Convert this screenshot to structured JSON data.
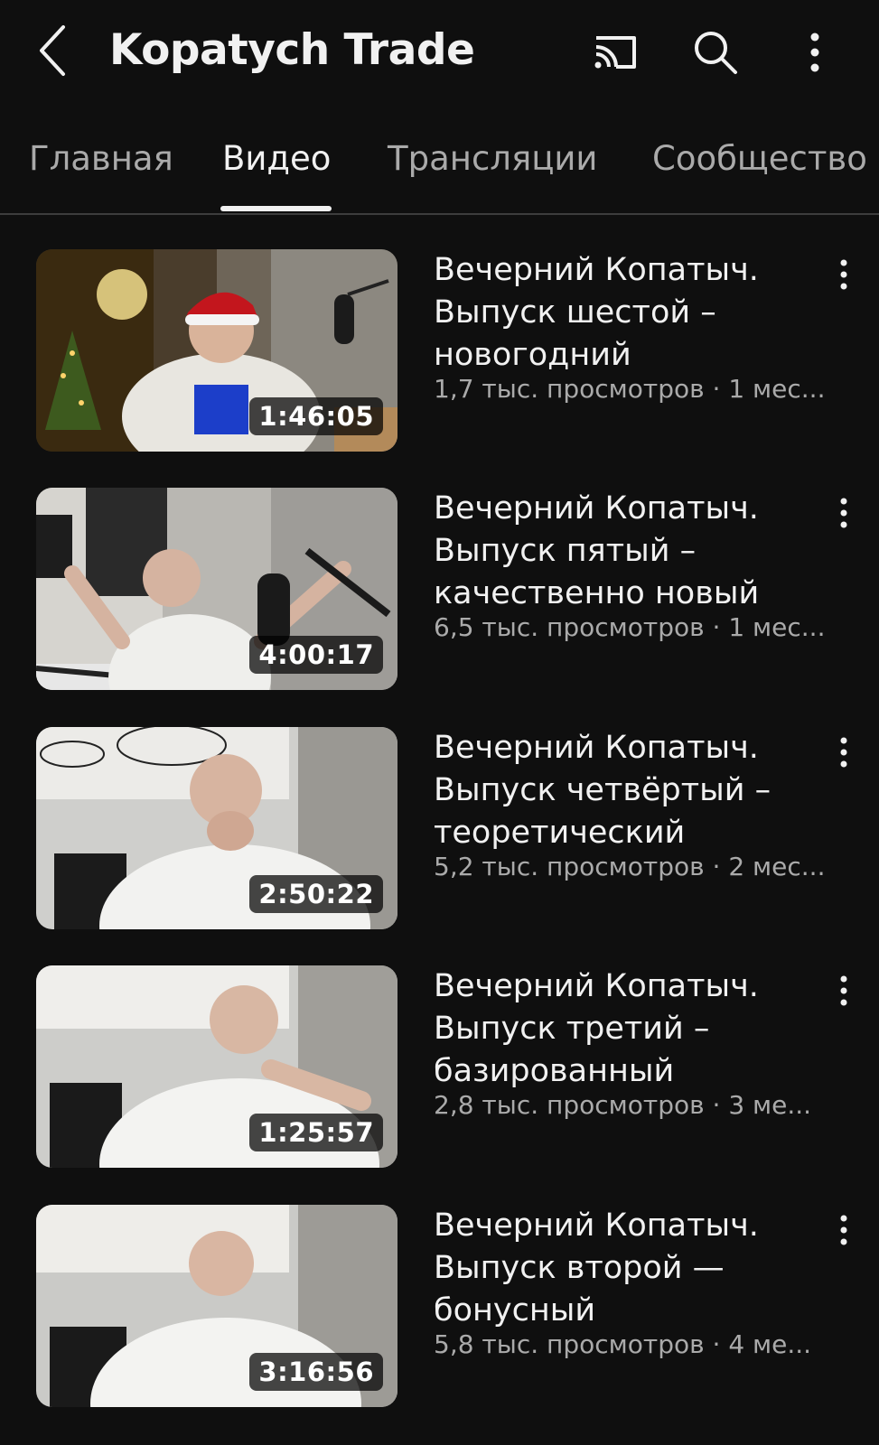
{
  "header": {
    "channel_name": "Kopatych Trade",
    "icons": {
      "back": "chevron-left-icon",
      "cast": "cast-icon",
      "search": "search-icon",
      "more": "more-vert-icon"
    }
  },
  "tabs": [
    {
      "label": "Главная",
      "active": false
    },
    {
      "label": "Видео",
      "active": true
    },
    {
      "label": "Трансляции",
      "active": false
    },
    {
      "label": "Сообщество",
      "active": false
    }
  ],
  "videos": [
    {
      "title": "Вечерний Копатыч. Выпуск шестой – новогодний",
      "meta": "1,7 тыс. просмотров · 1 мес...",
      "duration": "1:46:05"
    },
    {
      "title": "Вечерний Копатыч. Выпуск пятый – качественно новый",
      "meta": "6,5 тыс. просмотров · 1 мес...",
      "duration": "4:00:17"
    },
    {
      "title": "Вечерний Копатыч. Выпуск четвёртый – теоретический",
      "meta": "5,2 тыс. просмотров · 2 мес...",
      "duration": "2:50:22"
    },
    {
      "title": "Вечерний Копатыч. Выпуск третий – базированный",
      "meta": "2,8 тыс. просмотров · 3 ме...",
      "duration": "1:25:57"
    },
    {
      "title": "Вечерний Копатыч. Выпуск второй — бонусный",
      "meta": "5,8 тыс. просмотров · 4 ме...",
      "duration": "3:16:56"
    }
  ],
  "colors": {
    "background": "#0f0f0f",
    "text_primary": "#f1f1f1",
    "text_secondary": "#aaaaaa",
    "divider": "#3d3d3d"
  }
}
